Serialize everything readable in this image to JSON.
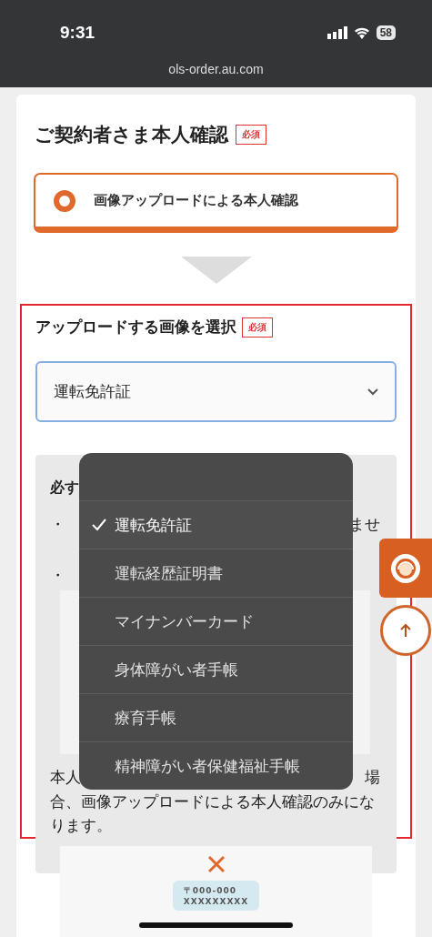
{
  "status_bar": {
    "time": "9:31",
    "battery": "58"
  },
  "browser": {
    "url": "ols-order.au.com"
  },
  "section": {
    "title": "ご契約者さま本人確認",
    "badge": "必須"
  },
  "method_option": {
    "label": "画像アップロードによる本人確認",
    "selected": true
  },
  "upload": {
    "title": "アップロードする画像を選択",
    "badge": "必須",
    "highlighted": true,
    "select": {
      "value": "運転免許証"
    }
  },
  "notice": {
    "heading": "必す",
    "bullets": [
      "・",
      "・"
    ],
    "line_tail": "ませ",
    "paragraph_start": "本人",
    "paragraph_end": "場",
    "paragraph_rest": "合、画像アップロードによる本人確認のみになります。"
  },
  "menu": {
    "options": [
      {
        "label": "運転免許証",
        "selected": true
      },
      {
        "label": "運転経歴証明書",
        "selected": false
      },
      {
        "label": "マイナンバーカード",
        "selected": false
      },
      {
        "label": "身体障がい者手帳",
        "selected": false
      },
      {
        "label": "療育手帳",
        "selected": false
      },
      {
        "label": "精神障がい者保健福祉手帳",
        "selected": false
      }
    ]
  },
  "example": {
    "postal": "〒000-000",
    "address": "XXXXXXXXX"
  }
}
